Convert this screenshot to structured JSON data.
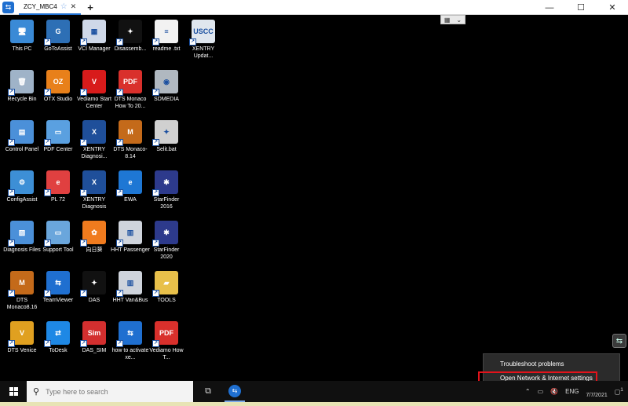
{
  "window": {
    "tab_title": "ZCY_MBC4",
    "new_tab": "+",
    "controls": [
      "—",
      "☐",
      "✕"
    ]
  },
  "desktop_icons": [
    {
      "label": "This PC",
      "icon": "computer-icon",
      "color": "#3a8ad6",
      "glyph": "🖥"
    },
    {
      "label": "GoToAssist",
      "icon": "gotoassist-icon",
      "color": "#2d6fb5",
      "glyph": "G"
    },
    {
      "label": "VCI Manager",
      "icon": "vci-manager-icon",
      "color": "#cfd8e8",
      "glyph": "▦"
    },
    {
      "label": "Disassemb...",
      "icon": "mercedes-star-icon",
      "color": "#111111",
      "glyph": "✦"
    },
    {
      "label": "readme .txt",
      "icon": "text-file-icon",
      "color": "#f2f2f2",
      "glyph": "≡"
    },
    {
      "label": "XENTRY Updat...",
      "icon": "xentry-update-icon",
      "color": "#dfe6ee",
      "glyph": "USCC"
    },
    {
      "label": "Recycle Bin",
      "icon": "recycle-bin-icon",
      "color": "#9fb3c8",
      "glyph": "🗑"
    },
    {
      "label": "OTX Studio",
      "icon": "otx-studio-icon",
      "color": "#e8801a",
      "glyph": "OZ"
    },
    {
      "label": "Vediamo Start Center",
      "icon": "vediamo-icon",
      "color": "#d81b1b",
      "glyph": "V"
    },
    {
      "label": "DTS Monaco How To 20...",
      "icon": "pdf-icon",
      "color": "#d9302c",
      "glyph": "PDF"
    },
    {
      "label": "SDMEDIA",
      "icon": "sdmedia-icon",
      "color": "#b0b8c0",
      "glyph": "◉"
    },
    {
      "label": "Control Panel",
      "icon": "control-panel-icon",
      "color": "#4b90d9",
      "glyph": "▤"
    },
    {
      "label": "PDF Center",
      "icon": "pdf-center-icon",
      "color": "#5aa0e0",
      "glyph": "▭"
    },
    {
      "label": "XENTRY Diagnosi...",
      "icon": "xentry-sim-icon",
      "color": "#1f4f9a",
      "glyph": "X"
    },
    {
      "label": "DTS Monaco-8.14",
      "icon": "dts-monaco-icon",
      "color": "#c46a1a",
      "glyph": "M"
    },
    {
      "label": "Selit.bat",
      "icon": "mercedes-star-icon",
      "color": "#d0d0d0",
      "glyph": "✦"
    },
    {
      "label": "ConfigAssist",
      "icon": "config-assist-icon",
      "color": "#3d8fd6",
      "glyph": "⚙"
    },
    {
      "label": "PL 72",
      "icon": "pl72-icon",
      "color": "#e04040",
      "glyph": "e"
    },
    {
      "label": "XENTRY Diagnosis",
      "icon": "xentry-icon",
      "color": "#1f4f9a",
      "glyph": "X"
    },
    {
      "label": "EWA",
      "icon": "ewa-icon",
      "color": "#1e77d4",
      "glyph": "e"
    },
    {
      "label": "StarFinder 2016",
      "icon": "starfinder-icon",
      "color": "#2d3a8c",
      "glyph": "✱"
    },
    {
      "label": "Diagnosis Files",
      "icon": "diagnosis-files-icon",
      "color": "#4b90d9",
      "glyph": "▧"
    },
    {
      "label": "Support Tool",
      "icon": "support-tool-icon",
      "color": "#6aa6dc",
      "glyph": "▭"
    },
    {
      "label": "向日葵",
      "icon": "sunflower-icon",
      "color": "#f07b1e",
      "glyph": "✿"
    },
    {
      "label": "HHT Passenger",
      "icon": "hht-icon",
      "color": "#cfd4dc",
      "glyph": "▥"
    },
    {
      "label": "StarFinder 2020",
      "icon": "starfinder-icon",
      "color": "#2d3a8c",
      "glyph": "✱"
    },
    {
      "label": "DTS Monaco8.16",
      "icon": "dts-monaco-icon",
      "color": "#c46a1a",
      "glyph": "M"
    },
    {
      "label": "TeamViewer",
      "icon": "teamviewer-icon",
      "color": "#1f6fd0",
      "glyph": "⇆"
    },
    {
      "label": "DAS",
      "icon": "mercedes-star-icon",
      "color": "#111111",
      "glyph": "✦"
    },
    {
      "label": "HHT Van&Bus",
      "icon": "hht-icon",
      "color": "#cfd4dc",
      "glyph": "▥"
    },
    {
      "label": "TOOLS",
      "icon": "folder-icon",
      "color": "#e8c04a",
      "glyph": "▰"
    },
    {
      "label": "DTS Venice",
      "icon": "dts-venice-icon",
      "color": "#e0a020",
      "glyph": "V"
    },
    {
      "label": "ToDesk",
      "icon": "todesk-icon",
      "color": "#1e88e5",
      "glyph": "⇄"
    },
    {
      "label": "DAS_SIM",
      "icon": "das-sim-icon",
      "color": "#d32f2f",
      "glyph": "Sim"
    },
    {
      "label": "how to activate xe...",
      "icon": "teamviewer-icon",
      "color": "#1f6fd0",
      "glyph": "⇆"
    },
    {
      "label": "Vediamo How T...",
      "icon": "pdf-icon",
      "color": "#d9302c",
      "glyph": "PDF"
    }
  ],
  "popup": {
    "item1": "Troubleshoot problems",
    "item2": "Open Network & Internet settings"
  },
  "taskbar": {
    "search_placeholder": "Type here to search",
    "lang": "ENG",
    "date": "7/7/2021",
    "notifications": "1"
  },
  "colors": {
    "accent": "#1f6fd0",
    "highlight": "#e3131b"
  }
}
